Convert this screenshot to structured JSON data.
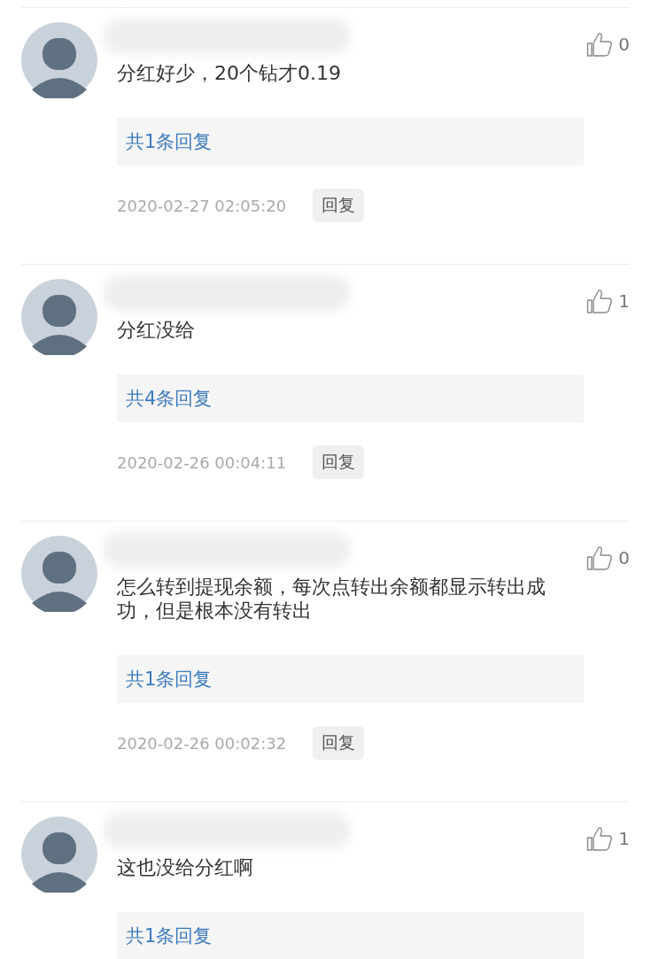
{
  "comments": [
    {
      "text": "分红好少，20个钻才0.19",
      "likes": "0",
      "replies_link": "共1条回复",
      "time": "2020-02-27 02:05:20",
      "reply_button": "回复"
    },
    {
      "text": "分红没给",
      "likes": "1",
      "replies_link": "共4条回复",
      "time": "2020-02-26 00:04:11",
      "reply_button": "回复"
    },
    {
      "text": "怎么转到提现余额，每次点转出余额都显示转出成功，但是根本没有转出",
      "likes": "0",
      "replies_link": "共1条回复",
      "time": "2020-02-26 00:02:32",
      "reply_button": "回复"
    },
    {
      "text": "这也没给分红啊",
      "likes": "1",
      "replies_link": "共1条回复"
    }
  ]
}
